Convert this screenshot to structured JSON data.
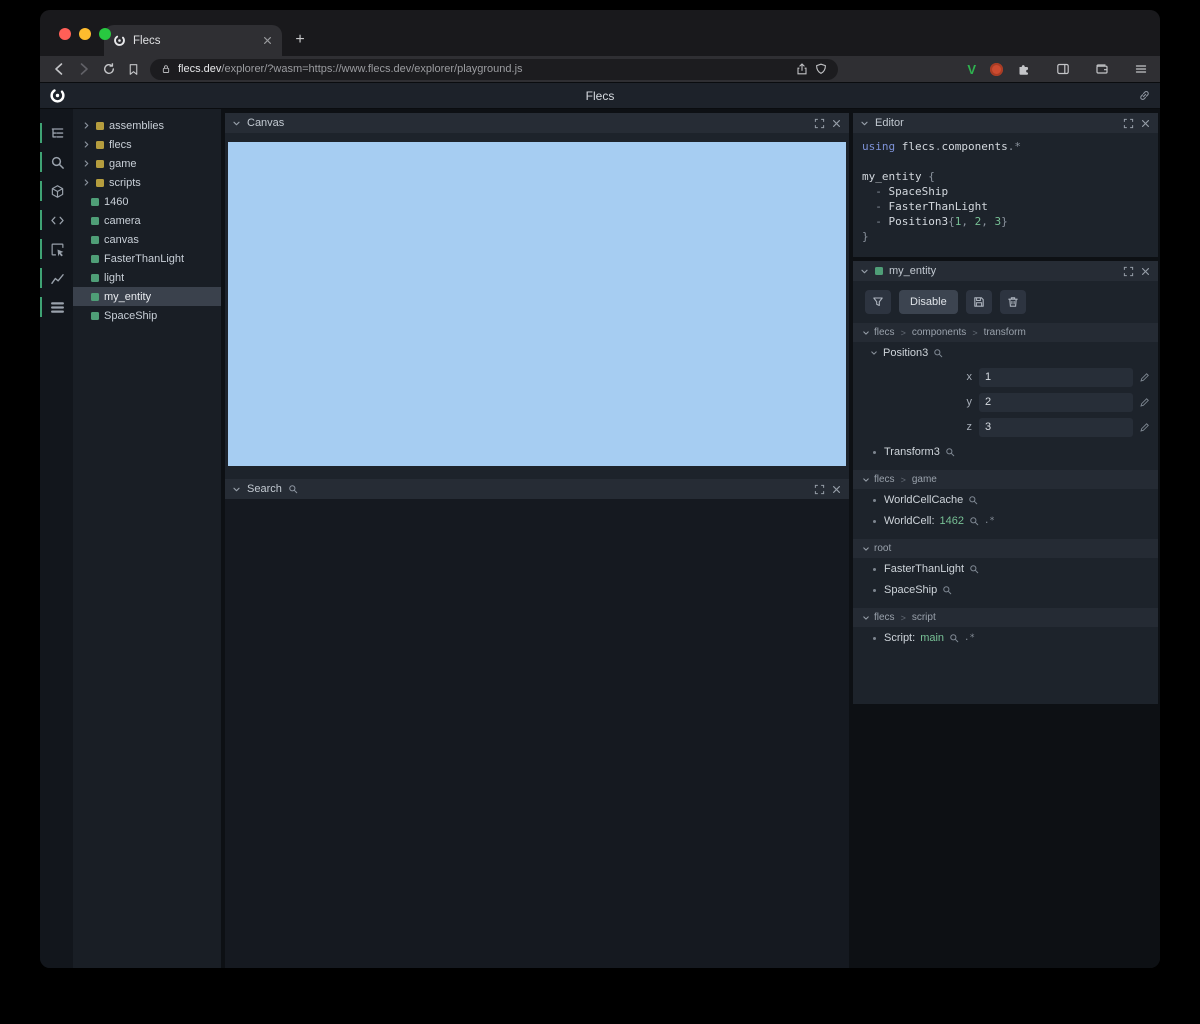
{
  "browser": {
    "tab_title": "Flecs",
    "new_tab_label": "+",
    "url_domain": "flecs.dev",
    "url_path": "/explorer/?wasm=https://www.flecs.dev/explorer/playground.js",
    "extension_v_label": "V"
  },
  "app": {
    "title": "Flecs"
  },
  "rail_icons": [
    "tree-view",
    "magnifier",
    "cube",
    "code",
    "inspect",
    "chart",
    "stats"
  ],
  "tree": {
    "items": [
      {
        "label": "assemblies",
        "kind": "module",
        "expandable": true
      },
      {
        "label": "flecs",
        "kind": "module",
        "expandable": true
      },
      {
        "label": "game",
        "kind": "module",
        "expandable": true
      },
      {
        "label": "scripts",
        "kind": "module",
        "expandable": true
      },
      {
        "label": "1460",
        "kind": "entity"
      },
      {
        "label": "camera",
        "kind": "entity"
      },
      {
        "label": "canvas",
        "kind": "entity"
      },
      {
        "label": "FasterThanLight",
        "kind": "entity"
      },
      {
        "label": "light",
        "kind": "entity"
      },
      {
        "label": "my_entity",
        "kind": "entity",
        "selected": true
      },
      {
        "label": "SpaceShip",
        "kind": "entity"
      }
    ]
  },
  "panels": {
    "canvas": {
      "title": "Canvas"
    },
    "search": {
      "title": "Search"
    },
    "editor": {
      "title": "Editor"
    },
    "inspector": {
      "title": "my_entity"
    }
  },
  "editor_code": {
    "lines": [
      [
        {
          "t": "using ",
          "c": "kw"
        },
        {
          "t": "flecs",
          "c": "id"
        },
        {
          "t": ".",
          "c": "pun"
        },
        {
          "t": "components",
          "c": "id"
        },
        {
          "t": ".",
          "c": "pun"
        },
        {
          "t": "*",
          "c": "pun"
        }
      ],
      [],
      [
        {
          "t": "my_entity",
          "c": "id"
        },
        {
          "t": " {",
          "c": "pun"
        }
      ],
      [
        {
          "t": "  - ",
          "c": "pun"
        },
        {
          "t": "SpaceShip",
          "c": "id"
        }
      ],
      [
        {
          "t": "  - ",
          "c": "pun"
        },
        {
          "t": "FasterThanLight",
          "c": "id"
        }
      ],
      [
        {
          "t": "  - ",
          "c": "pun"
        },
        {
          "t": "Position3",
          "c": "id"
        },
        {
          "t": "{",
          "c": "pun"
        },
        {
          "t": "1",
          "c": "num"
        },
        {
          "t": ", ",
          "c": "pun"
        },
        {
          "t": "2",
          "c": "num"
        },
        {
          "t": ", ",
          "c": "pun"
        },
        {
          "t": "3",
          "c": "num"
        },
        {
          "t": "}",
          "c": "pun"
        }
      ],
      [
        {
          "t": "}",
          "c": "pun"
        }
      ]
    ]
  },
  "inspector": {
    "toolbar": {
      "disable_label": "Disable"
    },
    "path_separator": ">",
    "sections": [
      {
        "path": [
          "flecs",
          "components",
          "transform"
        ],
        "items": [
          {
            "name": "Position3",
            "expanded": true,
            "fields": [
              {
                "label": "x",
                "value": "1"
              },
              {
                "label": "y",
                "value": "2"
              },
              {
                "label": "z",
                "value": "3"
              }
            ]
          },
          {
            "name": "Transform3"
          }
        ]
      },
      {
        "path": [
          "flecs",
          "game"
        ],
        "items": [
          {
            "name": "WorldCellCache"
          },
          {
            "name": "WorldCell:",
            "value": "1462",
            "suffix": ".*"
          }
        ]
      },
      {
        "path": [
          "root"
        ],
        "items": [
          {
            "name": "FasterThanLight"
          },
          {
            "name": "SpaceShip"
          }
        ]
      },
      {
        "path": [
          "flecs",
          "script"
        ],
        "items": [
          {
            "name": "Script:",
            "value": "main",
            "suffix": ".*"
          }
        ]
      }
    ]
  },
  "colors": {
    "canvas_blue": "#a6cdf2",
    "entity_green": "#4f9e77",
    "module_yellow": "#b59d3e",
    "accent_green": "#3fa374",
    "value_green": "#77c095"
  }
}
